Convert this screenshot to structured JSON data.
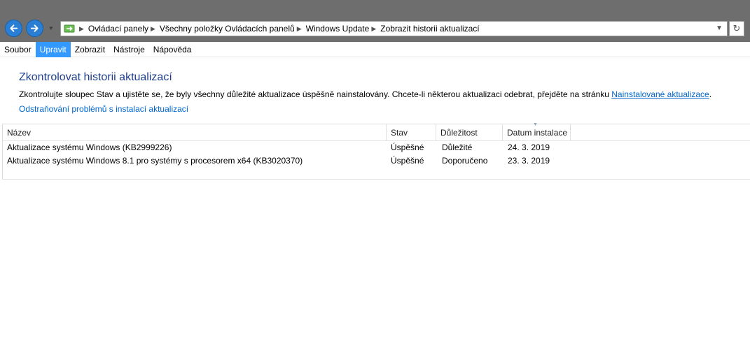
{
  "nav": {
    "back_icon": "arrow-left-icon",
    "forward_icon": "arrow-right-icon",
    "recent_icon": "chevron-down-icon",
    "accent": "#2a7fd4"
  },
  "address": {
    "icon": "control-panel-icon",
    "breadcrumbs": [
      "Ovládací panely",
      "Všechny položky Ovládacích panelů",
      "Windows Update",
      "Zobrazit historii aktualizací"
    ],
    "dropdown_icon": "chevron-down-icon",
    "refresh_icon": "refresh-icon"
  },
  "menu": {
    "items": [
      "Soubor",
      "Upravit",
      "Zobrazit",
      "Nástroje",
      "Nápověda"
    ],
    "active": "Upravit"
  },
  "main": {
    "title": "Zkontrolovat historii aktualizací",
    "description_text": "Zkontrolujte sloupec Stav a ujistěte se, že byly všechny důležité aktualizace úspěšně nainstalovány. Chcete-li některou aktualizaci odebrat, přejděte na stránku",
    "description_link": "Nainstalované aktualizace",
    "description_end": ".",
    "troubleshoot_link": "Odstraňování problémů s instalací aktualizací"
  },
  "table": {
    "columns": [
      "Název",
      "Stav",
      "Důležitost",
      "Datum instalace"
    ],
    "rows": [
      [
        "Aktualizace systému Windows (KB2999226)",
        "Úspěšné",
        "Důležité",
        "24. 3. 2019"
      ],
      [
        "Aktualizace systému Windows 8.1 pro systémy s procesorem x64 (KB3020370)",
        "Úspěšné",
        "Doporučeno",
        "23. 3. 2019"
      ]
    ]
  }
}
